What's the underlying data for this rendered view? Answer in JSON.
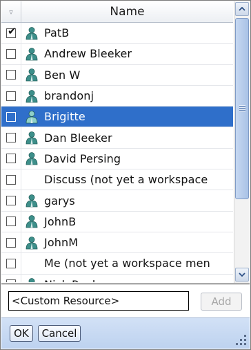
{
  "header": {
    "filter_glyph": "▿",
    "name_label": "Name"
  },
  "rows": [
    {
      "label": "PatB",
      "checked": true,
      "icon": "user-icon",
      "selected": false
    },
    {
      "label": "Andrew Bleeker",
      "checked": false,
      "icon": "user-icon",
      "selected": false
    },
    {
      "label": "Ben W",
      "checked": false,
      "icon": "user-icon",
      "selected": false
    },
    {
      "label": "brandonj",
      "checked": false,
      "icon": "user-icon",
      "selected": false
    },
    {
      "label": "Brigitte",
      "checked": false,
      "icon": "user-icon",
      "selected": true
    },
    {
      "label": "Dan Bleeker",
      "checked": false,
      "icon": "user-icon",
      "selected": false
    },
    {
      "label": "David Persing",
      "checked": false,
      "icon": "user-icon",
      "selected": false
    },
    {
      "label": "Discuss  (not yet a workspace",
      "checked": false,
      "icon": null,
      "selected": false
    },
    {
      "label": "garys",
      "checked": false,
      "icon": "user-icon",
      "selected": false
    },
    {
      "label": "JohnB",
      "checked": false,
      "icon": "user-icon",
      "selected": false
    },
    {
      "label": "JohnM",
      "checked": false,
      "icon": "user-icon",
      "selected": false
    },
    {
      "label": "Me  (not yet a workspace men",
      "checked": false,
      "icon": null,
      "selected": false
    },
    {
      "label": "Nick Ryabov",
      "checked": false,
      "icon": "user-icon",
      "selected": false
    }
  ],
  "custom_resource": {
    "value": "<Custom Resource>"
  },
  "add_button": {
    "label": "Add"
  },
  "footer": {
    "ok_label": "OK",
    "cancel_label": "Cancel"
  },
  "colors": {
    "selection": "#2f6fca",
    "user_icon": "#3d8f8a"
  }
}
